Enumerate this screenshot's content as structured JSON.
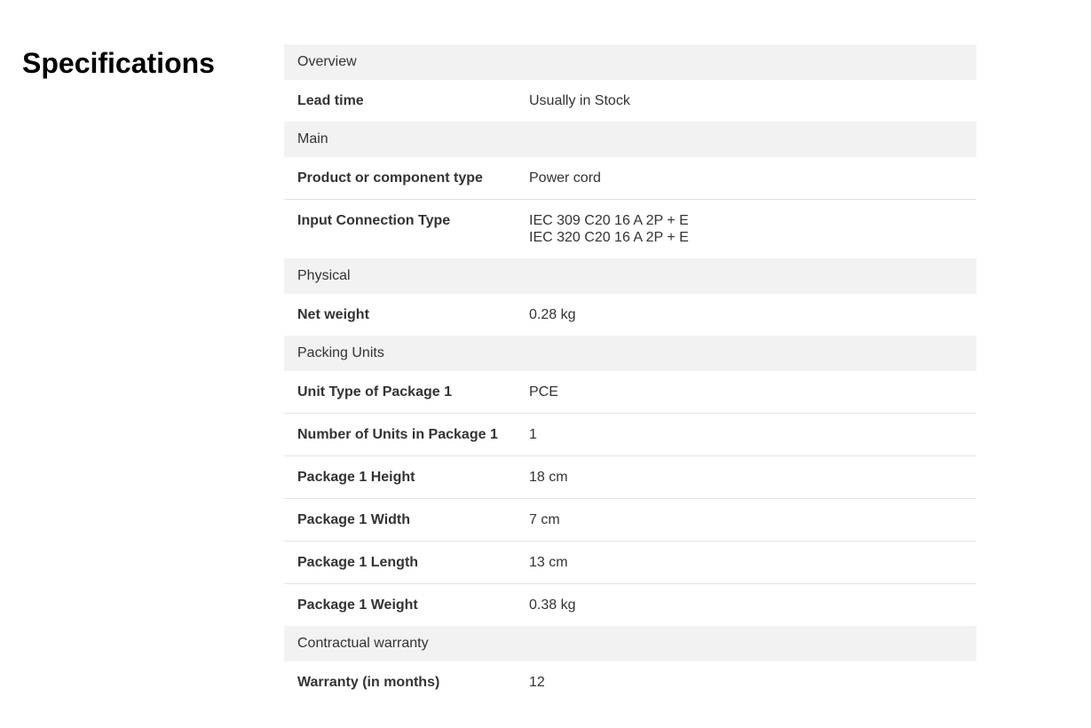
{
  "title": "Specifications",
  "sections": [
    {
      "header": "Overview",
      "rows": [
        {
          "label": "Lead time",
          "values": [
            "Usually in Stock"
          ]
        }
      ]
    },
    {
      "header": "Main",
      "rows": [
        {
          "label": "Product or component type",
          "values": [
            "Power cord"
          ]
        },
        {
          "label": "Input Connection Type",
          "values": [
            "IEC 309 C20 16 A 2P + E",
            "IEC 320 C20 16 A 2P + E"
          ]
        }
      ]
    },
    {
      "header": "Physical",
      "rows": [
        {
          "label": "Net weight",
          "values": [
            "0.28 kg"
          ]
        }
      ]
    },
    {
      "header": "Packing Units",
      "rows": [
        {
          "label": "Unit Type of Package 1",
          "values": [
            "PCE"
          ]
        },
        {
          "label": "Number of Units in Package 1",
          "values": [
            "1"
          ]
        },
        {
          "label": "Package 1 Height",
          "values": [
            "18 cm"
          ]
        },
        {
          "label": "Package 1 Width",
          "values": [
            "7 cm"
          ]
        },
        {
          "label": "Package 1 Length",
          "values": [
            "13 cm"
          ]
        },
        {
          "label": "Package 1 Weight",
          "values": [
            "0.38 kg"
          ]
        }
      ]
    },
    {
      "header": "Contractual warranty",
      "rows": [
        {
          "label": "Warranty (in months)",
          "values": [
            "12"
          ]
        }
      ]
    }
  ]
}
